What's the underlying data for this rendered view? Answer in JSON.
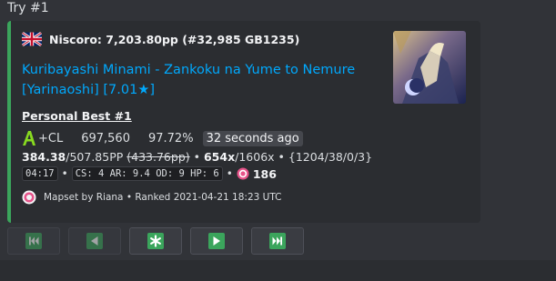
{
  "message": {
    "title": "Try #1"
  },
  "embed": {
    "accent_color": "#3ba55c",
    "author": {
      "flag_icon": "uk-flag-icon",
      "text": "Niscoro: 7,203.80pp (#32,985 GB1235)"
    },
    "title": "Kuribayashi Minami - Zankoku na Yume to Nemure [Yarinaoshi] [7.01★]",
    "field": {
      "name": "Personal Best #1",
      "rank_icon": "rank-a-icon",
      "mods": "+CL",
      "score": "697,560",
      "accuracy": "97.72%",
      "time_ago": "32 seconds ago",
      "pp_value": "384.38",
      "pp_max": "/507.85PP",
      "pp_fc": "(433.76pp)",
      "combo": "654x",
      "max_combo": "/1606x",
      "hits": "{1204/38/0/3}",
      "length": "04:17",
      "stats": "CS: 4 AR: 9.4 OD: 9 HP: 6",
      "osu_icon": "osu-favourite-icon",
      "favourites": "186",
      "sep": "•"
    },
    "footer": {
      "icon": "osu-logo-icon",
      "text": "Mapset by Riana • Ranked 2021-04-21 18:23 UTC"
    },
    "thumbnail": "beatmap-cover-image"
  },
  "buttons": [
    {
      "icon": "skip-to-first-icon",
      "disabled": true
    },
    {
      "icon": "previous-icon",
      "disabled": true
    },
    {
      "icon": "asterisk-icon",
      "disabled": false
    },
    {
      "icon": "next-icon",
      "disabled": false
    },
    {
      "icon": "skip-to-last-icon",
      "disabled": false
    }
  ],
  "colors": {
    "background": "#313338",
    "embed_background": "#2b2d31",
    "link": "#00a8fc",
    "button_green": "#3ba55c",
    "rank_a": "#88da20",
    "osu_pink": "#e6538a"
  }
}
